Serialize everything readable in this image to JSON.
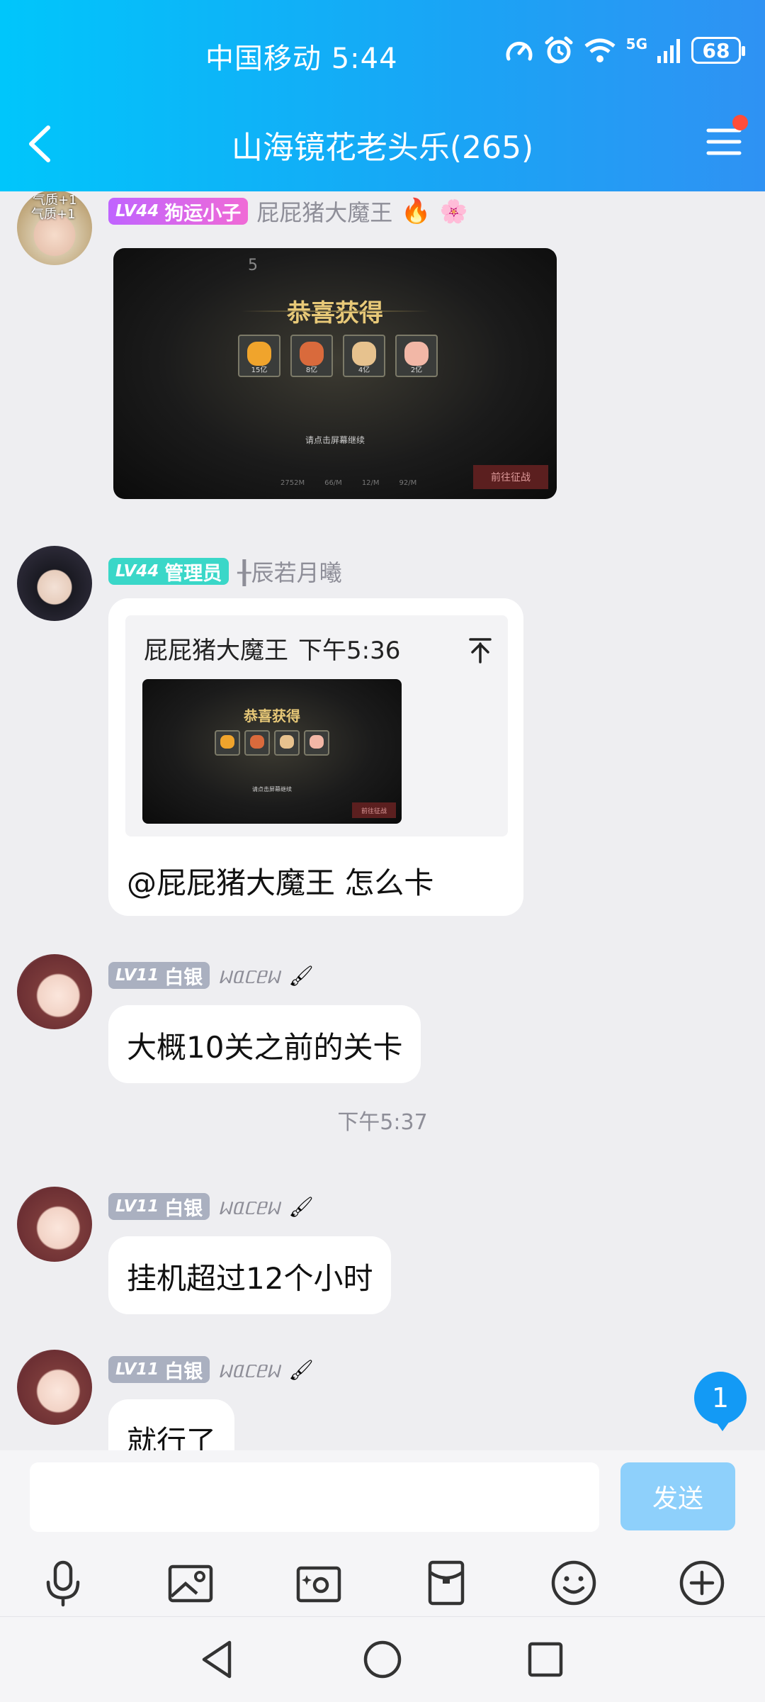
{
  "status_bar": {
    "carrier_time": "中国移动 5:44",
    "network": "5G",
    "battery": "68"
  },
  "header": {
    "title": "山海镜花老头乐(265)"
  },
  "messages": [
    {
      "badge_level": "LV44",
      "badge_title": "狗运小子",
      "nickname": "屁屁猪大魔王",
      "avatar_overlay": [
        "气质+1",
        "气质+1"
      ],
      "image": {
        "title": "恭喜获得",
        "items": [
          "15亿",
          "8亿",
          "4亿",
          "2亿"
        ],
        "hint": "请点击屏幕继续",
        "stats": [
          "2752M",
          "66/M",
          "12/M",
          "92/M"
        ],
        "button": "前往征战",
        "corner_num": "5"
      }
    },
    {
      "badge_level": "LV44",
      "badge_title": "管理员",
      "nickname": "╂辰若月曦",
      "quote": {
        "author": "屁屁猪大魔王",
        "time": "下午5:36",
        "image": {
          "title": "恭喜获得",
          "hint": "请点击屏幕继续",
          "button": "前往征战"
        }
      },
      "text": "@屁屁猪大魔王 怎么卡"
    },
    {
      "badge_level": "LV11",
      "badge_title": "白银",
      "nickname": "ᥕᥲᥴᥱᥕ",
      "text": "大概10关之前的关卡"
    },
    {
      "badge_level": "LV11",
      "badge_title": "白银",
      "nickname": "ᥕᥲᥴᥱᥕ",
      "text": "挂机超过12个小时"
    },
    {
      "badge_level": "LV11",
      "badge_title": "白银",
      "nickname": "ᥕᥲᥴᥱᥕ",
      "text": "就行了"
    }
  ],
  "time_divider": "下午5:37",
  "unread_count": "1",
  "input": {
    "placeholder": "",
    "send_label": "发送"
  },
  "toolbar_icons": [
    "mic-icon",
    "image-icon",
    "camera-icon",
    "red-packet-icon",
    "emoji-icon",
    "plus-icon"
  ],
  "colors": {
    "header_start": "#00c6fb",
    "header_end": "#2f92f3",
    "badge_purple": "#c064ff",
    "badge_teal": "#3ad7c8",
    "badge_gray": "#aab0c0",
    "send_button": "#8ed0fb",
    "unread_badge": "#139af5"
  }
}
